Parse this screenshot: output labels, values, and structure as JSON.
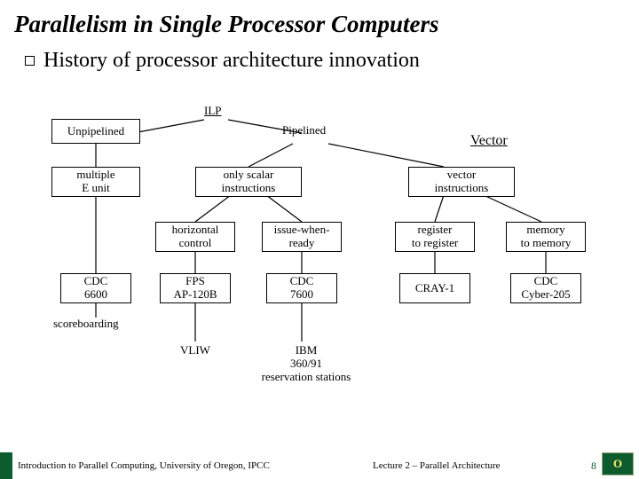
{
  "title": "Parallelism in Single Processor Computers",
  "subtitle": "History of processor architecture innovation",
  "diagram": {
    "root": "ILP",
    "branches": {
      "left": "Unpipelined",
      "right": "Pipelined",
      "right_far": "Vector"
    },
    "layer2": {
      "l": {
        "line1": "multiple",
        "line2": "E unit"
      },
      "m": {
        "line1": "only scalar",
        "line2": "instructions"
      },
      "r": {
        "line1": "vector",
        "line2": "instructions"
      }
    },
    "layer3": {
      "a": {
        "line1": "horizontal",
        "line2": "control"
      },
      "b": {
        "line1": "issue-when-",
        "line2": "ready"
      },
      "c": {
        "line1": "register",
        "line2": "to register"
      },
      "d": {
        "line1": "memory",
        "line2": "to memory"
      }
    },
    "leaves": {
      "cdc6600": {
        "line1": "CDC",
        "line2": "6600"
      },
      "fps": {
        "line1": "FPS",
        "line2": "AP-120B"
      },
      "cdc7600": {
        "line1": "CDC",
        "line2": "7600"
      },
      "cray": "CRAY-1",
      "cyber": {
        "line1": "CDC",
        "line2": "Cyber-205"
      }
    },
    "scoreboarding": "scoreboarding",
    "vliw": "VLIW",
    "ibm": {
      "line1": "IBM",
      "line2": "360/91",
      "line3": "reservation stations"
    }
  },
  "footer": {
    "left": "Introduction to Parallel Computing, University of Oregon, IPCC",
    "mid": "Lecture 2 – Parallel Architecture",
    "page": "8",
    "logo": "O"
  }
}
